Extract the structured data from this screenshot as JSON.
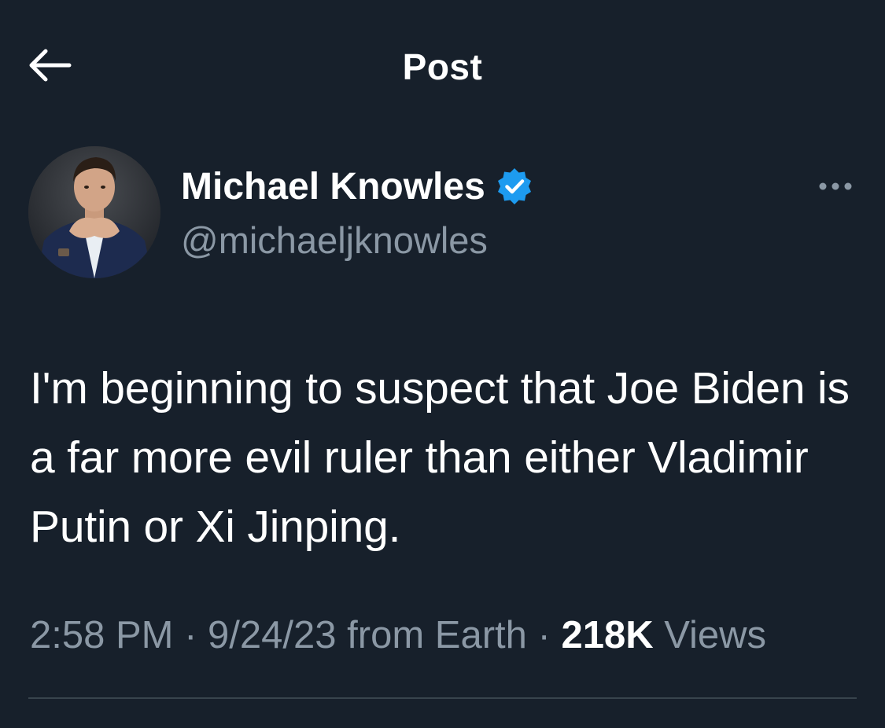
{
  "header": {
    "title": "Post",
    "back_icon": "arrow-left-icon"
  },
  "author": {
    "name": "Michael Knowles",
    "handle": "@michaeljknowles",
    "verified": true,
    "verified_color": "#1d9bf0"
  },
  "post": {
    "text": "I'm beginning to suspect that Joe Biden is a far more evil ruler than either Vladimir Putin or Xi Jinping.",
    "time": "2:58 PM",
    "date": "9/24/23",
    "source": "from Earth",
    "views_count": "218K",
    "views_label": "Views"
  },
  "colors": {
    "background": "#17202b",
    "secondary_text": "#8b98a5",
    "divider": "#38444d"
  }
}
